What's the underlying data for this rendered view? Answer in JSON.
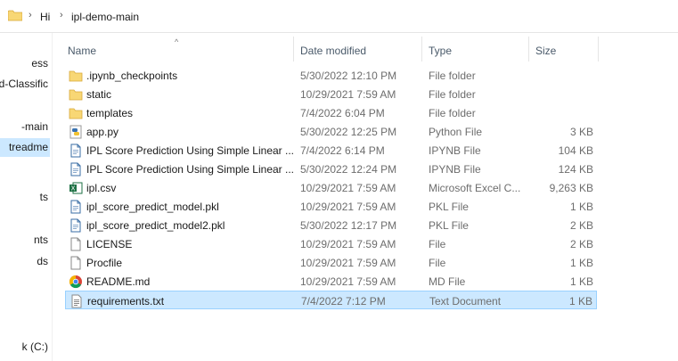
{
  "breadcrumb": {
    "items": [
      "Hi",
      "ipl-demo-main"
    ]
  },
  "nav": {
    "items": [
      {
        "label": "ess"
      },
      {
        "label": "ed-Classific"
      },
      {
        "label": "-main"
      },
      {
        "label": "treadme",
        "selected": true
      },
      {
        "label": "ts"
      },
      {
        "label": "nts"
      },
      {
        "label": "ds"
      },
      {
        "label": "k (C:)"
      }
    ]
  },
  "columns": {
    "name": "Name",
    "date": "Date modified",
    "type": "Type",
    "size": "Size"
  },
  "files": [
    {
      "name": ".ipynb_checkpoints",
      "date": "5/30/2022 12:10 PM",
      "type": "File folder",
      "size": "",
      "icon": "folder-icon"
    },
    {
      "name": "static",
      "date": "10/29/2021 7:59 AM",
      "type": "File folder",
      "size": "",
      "icon": "folder-icon"
    },
    {
      "name": "templates",
      "date": "7/4/2022 6:04 PM",
      "type": "File folder",
      "size": "",
      "icon": "folder-icon"
    },
    {
      "name": "app.py",
      "date": "5/30/2022 12:25 PM",
      "type": "Python File",
      "size": "3 KB",
      "icon": "python-file-icon"
    },
    {
      "name": "IPL Score Prediction Using Simple Linear ...",
      "date": "7/4/2022 6:14 PM",
      "type": "IPYNB File",
      "size": "104 KB",
      "icon": "generic-file-icon"
    },
    {
      "name": "IPL Score Prediction Using Simple Linear ...",
      "date": "5/30/2022 12:24 PM",
      "type": "IPYNB File",
      "size": "124 KB",
      "icon": "generic-file-icon"
    },
    {
      "name": "ipl.csv",
      "date": "10/29/2021 7:59 AM",
      "type": "Microsoft Excel C...",
      "size": "9,263 KB",
      "icon": "excel-file-icon"
    },
    {
      "name": "ipl_score_predict_model.pkl",
      "date": "10/29/2021 7:59 AM",
      "type": "PKL File",
      "size": "1 KB",
      "icon": "generic-file-icon"
    },
    {
      "name": "ipl_score_predict_model2.pkl",
      "date": "5/30/2022 12:17 PM",
      "type": "PKL File",
      "size": "2 KB",
      "icon": "generic-file-icon"
    },
    {
      "name": "LICENSE",
      "date": "10/29/2021 7:59 AM",
      "type": "File",
      "size": "2 KB",
      "icon": "blank-file-icon"
    },
    {
      "name": "Procfile",
      "date": "10/29/2021 7:59 AM",
      "type": "File",
      "size": "1 KB",
      "icon": "blank-file-icon"
    },
    {
      "name": "README.md",
      "date": "10/29/2021 7:59 AM",
      "type": "MD File",
      "size": "1 KB",
      "icon": "chrome-icon"
    },
    {
      "name": "requirements.txt",
      "date": "7/4/2022 7:12 PM",
      "type": "Text Document",
      "size": "1 KB",
      "icon": "text-file-icon",
      "selected": true
    }
  ],
  "colors": {
    "folder": "#f8d775",
    "selection": "#cce8ff",
    "selection_border": "#99d1ff"
  }
}
